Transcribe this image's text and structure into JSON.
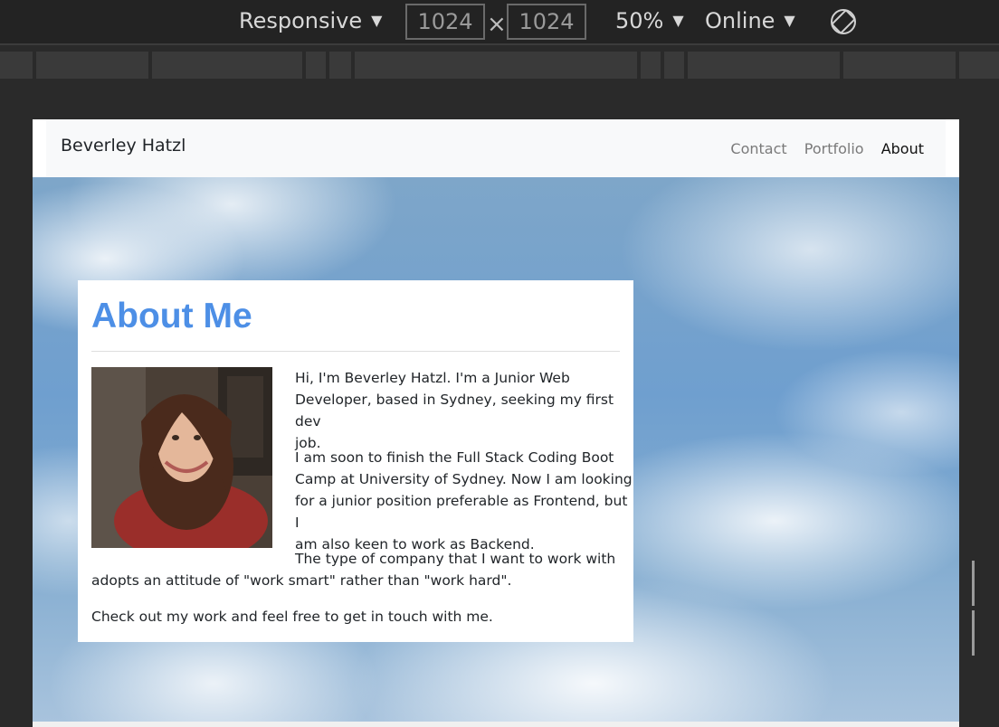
{
  "devtools": {
    "device_label": "Responsive",
    "width_value": "1024",
    "height_value": "1024",
    "times_symbol": "×",
    "zoom_label": "50%",
    "network_label": "Online",
    "dropdown_arrow": "▼",
    "rotate_icon": "rotate-icon"
  },
  "navbar": {
    "brand": "Beverley Hatzl",
    "links": [
      {
        "label": "Contact",
        "active": false
      },
      {
        "label": "Portfolio",
        "active": false
      },
      {
        "label": "About",
        "active": true
      }
    ]
  },
  "about": {
    "title": "About Me",
    "paragraph1": [
      "Hi, I'm Beverley Hatzl. I'm a Junior Web",
      "Developer, based in Sydney, seeking my first dev",
      "job."
    ],
    "paragraph2": [
      "I am soon to finish the Full Stack Coding Boot",
      "Camp at University of Sydney. Now I am looking",
      "for a junior position preferable as Frontend, but I",
      "am also keen to work as Backend."
    ],
    "paragraph3": [
      "The type of company that I want to work with",
      "adopts an attitude of \"work smart\" rather than \"work hard\"."
    ],
    "paragraph4": "Check out my work and feel free to get in touch with me."
  },
  "colors": {
    "heading": "#4d8fe6",
    "devtools_bg": "#232323",
    "navbar_bg": "#f8f9fa"
  }
}
